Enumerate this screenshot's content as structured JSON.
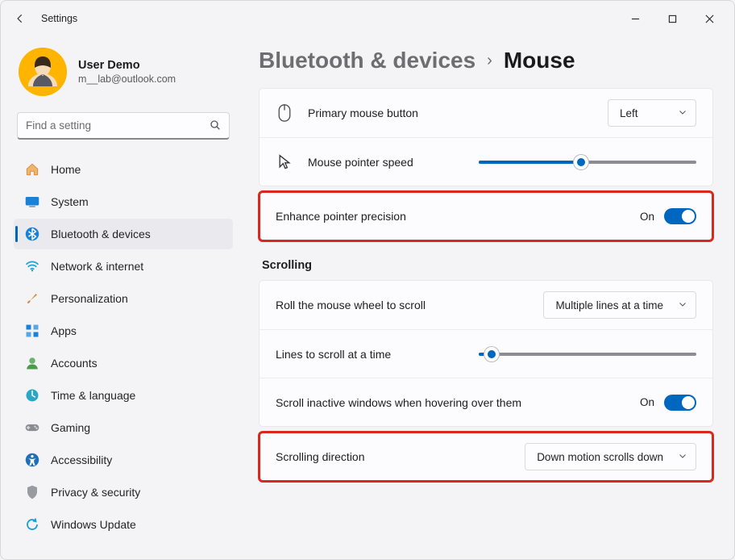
{
  "window": {
    "title": "Settings"
  },
  "user": {
    "name": "User Demo",
    "email": "m__lab@outlook.com"
  },
  "search": {
    "placeholder": "Find a setting"
  },
  "nav": {
    "items": [
      {
        "label": "Home"
      },
      {
        "label": "System"
      },
      {
        "label": "Bluetooth & devices"
      },
      {
        "label": "Network & internet"
      },
      {
        "label": "Personalization"
      },
      {
        "label": "Apps"
      },
      {
        "label": "Accounts"
      },
      {
        "label": "Time & language"
      },
      {
        "label": "Gaming"
      },
      {
        "label": "Accessibility"
      },
      {
        "label": "Privacy & security"
      },
      {
        "label": "Windows Update"
      }
    ],
    "active_index": 2
  },
  "breadcrumb": {
    "parent": "Bluetooth & devices",
    "current": "Mouse"
  },
  "rows": {
    "primary_button": {
      "label": "Primary mouse button",
      "value": "Left"
    },
    "pointer_speed": {
      "label": "Mouse pointer speed",
      "percent": 47
    },
    "enhance_precision": {
      "label": "Enhance pointer precision",
      "state": "On"
    },
    "scrolling_header": "Scrolling",
    "roll_wheel": {
      "label": "Roll the mouse wheel to scroll",
      "value": "Multiple lines at a time"
    },
    "lines_to_scroll": {
      "label": "Lines to scroll at a time",
      "percent": 6
    },
    "scroll_inactive": {
      "label": "Scroll inactive windows when hovering over them",
      "state": "On"
    },
    "scroll_direction": {
      "label": "Scrolling direction",
      "value": "Down motion scrolls down"
    }
  }
}
